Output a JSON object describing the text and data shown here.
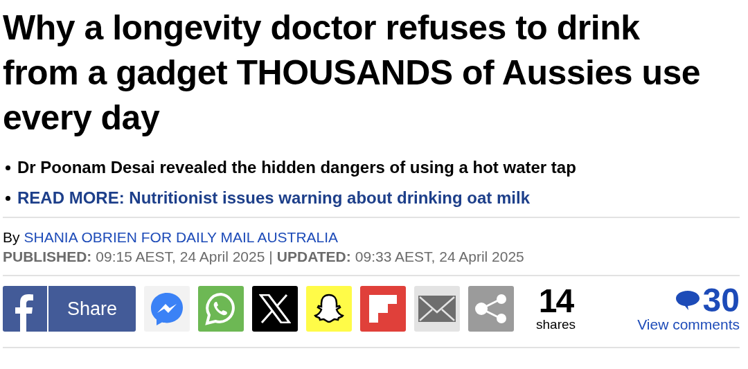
{
  "headline": "Why a longevity doctor refuses to drink from a gadget THOUSANDS of Aussies use every day",
  "bullets": [
    {
      "kind": "summary",
      "text": "Dr Poonam Desai revealed the hidden dangers of using a hot water tap"
    },
    {
      "kind": "link",
      "text": "READ MORE: Nutritionist issues warning about drinking oat milk"
    }
  ],
  "byline": {
    "prefix": "By",
    "author": "SHANIA OBRIEN FOR DAILY MAIL AUSTRALIA"
  },
  "dates": {
    "published_label": "PUBLISHED:",
    "published": "09:15 AEST, 24 April 2025",
    "separator": "|",
    "updated_label": "UPDATED:",
    "updated": "09:33 AEST, 24 April 2025"
  },
  "share_buttons": [
    {
      "kind": "facebook",
      "label": "Share"
    },
    {
      "kind": "messenger"
    },
    {
      "kind": "whatsapp"
    },
    {
      "kind": "x"
    },
    {
      "kind": "snapchat"
    },
    {
      "kind": "flipboard"
    },
    {
      "kind": "email"
    },
    {
      "kind": "share"
    }
  ],
  "shares": {
    "count": "14",
    "label": "shares"
  },
  "comments": {
    "count": "30",
    "label": "View comments"
  }
}
